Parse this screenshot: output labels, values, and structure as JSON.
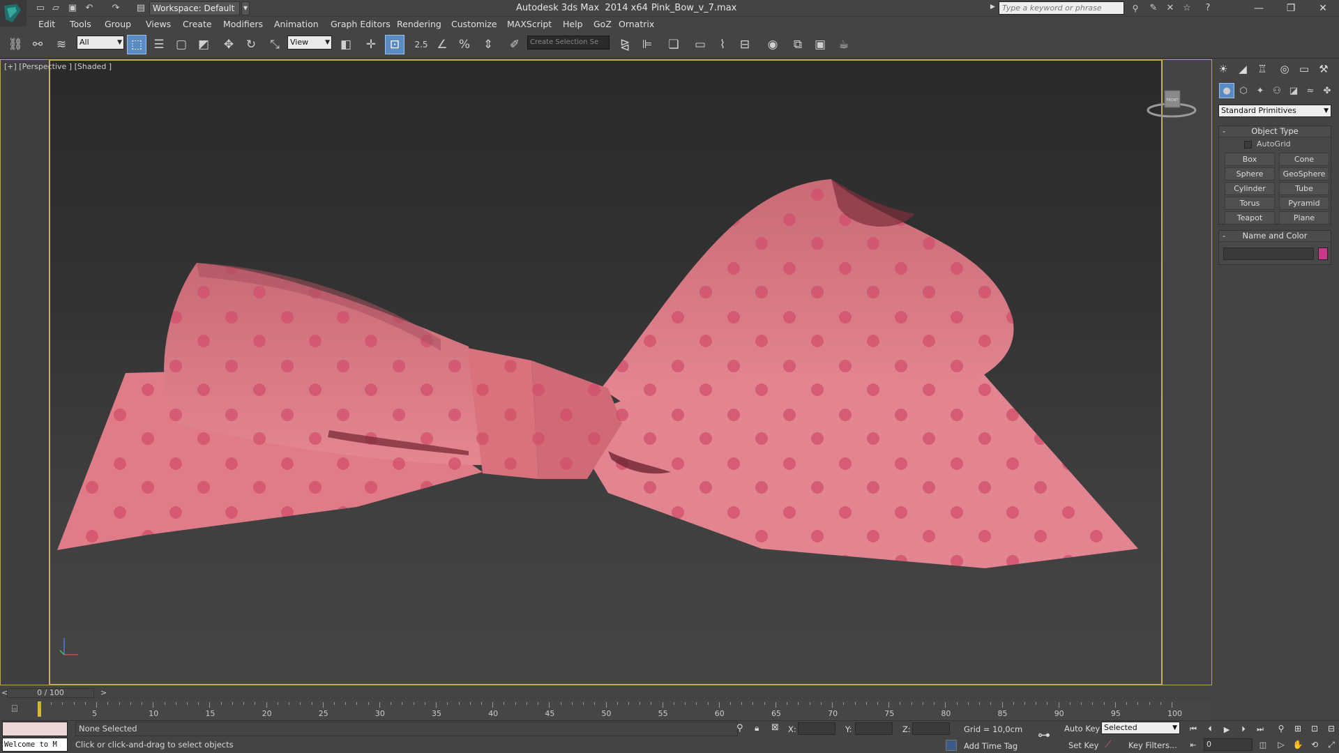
{
  "titlebar": {
    "workspace": "Workspace: Default",
    "app_title": "Autodesk 3ds Max  2014 x64",
    "file_name": "Pink_Bow_v_7.max",
    "search_placeholder": "Type a keyword or phrase"
  },
  "menu": [
    "Edit",
    "Tools",
    "Group",
    "Views",
    "Create",
    "Modifiers",
    "Animation",
    "Graph Editors",
    "Rendering",
    "Customize",
    "MAXScript",
    "Help",
    "GoZ",
    "Ornatrix"
  ],
  "toolbar": {
    "selection_filter": "All",
    "ref_coord": "View",
    "snap_value": "2.5",
    "selection_set_placeholder": "Create Selection Se"
  },
  "viewport": {
    "label": "[+] [Perspective ] [Shaded ]",
    "viewcube_face": "FRONT",
    "bow_colors": {
      "fabric": "#e07b86",
      "dot": "#d24e68",
      "shadow": "#9a4050"
    }
  },
  "command_panel": {
    "category": "Standard Primitives",
    "object_type_title": "Object Type",
    "autogrid": "AutoGrid",
    "primitives": [
      "Box",
      "Cone",
      "Sphere",
      "GeoSphere",
      "Cylinder",
      "Tube",
      "Torus",
      "Pyramid",
      "Teapot",
      "Plane"
    ],
    "name_color_title": "Name and Color",
    "swatch_color": "#c8388c"
  },
  "timeline": {
    "frame_display": "0 / 100",
    "ticks": [
      "5",
      "10",
      "15",
      "20",
      "25",
      "30",
      "35",
      "40",
      "45",
      "50",
      "55",
      "60",
      "65",
      "70",
      "75",
      "80",
      "85",
      "90",
      "95",
      "100"
    ]
  },
  "status": {
    "welcome": "Welcome to M",
    "selection": "None Selected",
    "prompt": "Click or click-and-drag to select objects",
    "x_label": "X:",
    "y_label": "Y:",
    "z_label": "Z:",
    "grid": "Grid = 10,0cm",
    "add_time_tag": "Add Time Tag",
    "auto_key": "Auto Key",
    "set_key": "Set Key",
    "key_mode": "Selected",
    "key_filters": "Key Filters...",
    "current_frame": "0"
  }
}
